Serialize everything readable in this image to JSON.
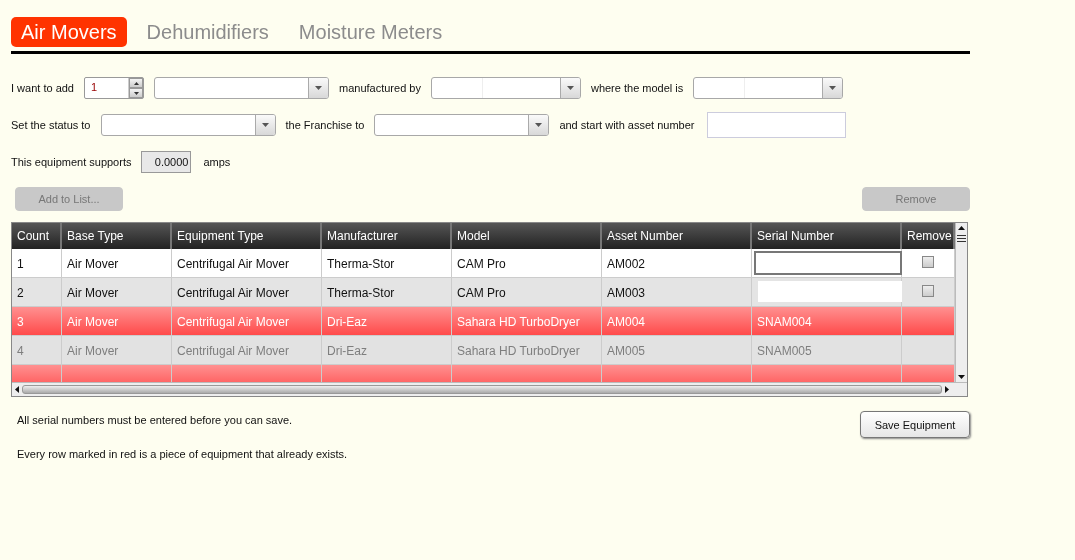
{
  "tabs": [
    {
      "label": "Air Movers",
      "selected": true
    },
    {
      "label": "Dehumidifiers",
      "selected": false
    },
    {
      "label": "Moisture Meters",
      "selected": false
    }
  ],
  "form": {
    "rows": [
      [
        {
          "kind": "label",
          "text": "I want to add"
        },
        {
          "kind": "spinner",
          "value": "1"
        },
        {
          "kind": "dropdown"
        },
        {
          "kind": "label",
          "text": "manufactured by"
        },
        {
          "kind": "split-dropdown"
        },
        {
          "kind": "label",
          "text": "where the model is"
        },
        {
          "kind": "split-dropdown"
        }
      ],
      [
        {
          "kind": "label",
          "text": "Set the status to"
        },
        {
          "kind": "dropdown"
        },
        {
          "kind": "label",
          "text": "the Franchise to"
        },
        {
          "kind": "dropdown"
        },
        {
          "kind": "label",
          "text": "and start with asset number"
        },
        {
          "kind": "textbox"
        }
      ],
      [
        {
          "kind": "label",
          "text": "This equipment supports"
        },
        {
          "kind": "readout",
          "value": "0.0000"
        },
        {
          "kind": "label",
          "text": "amps"
        }
      ]
    ]
  },
  "actions": [
    {
      "label": "Add to List...",
      "disabled": true
    },
    {
      "label": "Remove",
      "disabled": true
    }
  ],
  "grid": {
    "columns": [
      "Count",
      "Base Type",
      "Equipment Type",
      "Manufacturer",
      "Model",
      "Asset Number",
      "Serial Number",
      "Remove"
    ],
    "rows": [
      {
        "kind": "new",
        "cells": [
          "1",
          "Air Mover",
          "Centrifugal Air Mover",
          "Therma-Stor",
          "CAM Pro",
          "AM002"
        ],
        "serial_focused": true,
        "remove_checked": false
      },
      {
        "kind": "new",
        "cells": [
          "2",
          "Air Mover",
          "Centrifugal Air Mover",
          "Therma-Stor",
          "CAM Pro",
          "AM003"
        ],
        "serial_focused": false,
        "remove_checked": false
      },
      {
        "kind": "existing",
        "cells": [
          "3",
          "Air Mover",
          "Centrifugal Air Mover",
          "Dri-Eaz",
          "Sahara HD TurboDryer",
          "AM004",
          "SNAM004"
        ]
      },
      {
        "kind": "faded",
        "cells": [
          "4",
          "Air Mover",
          "Centrifugal Air Mover",
          "Dri-Eaz",
          "Sahara HD TurboDryer",
          "AM005",
          "SNAM005"
        ]
      },
      {
        "kind": "existing"
      }
    ]
  },
  "notes": [
    "All serial numbers must be entered before you can save.",
    "Every row marked in red is a piece of equipment that already exists."
  ],
  "save_button": {
    "label": "Save Equipment",
    "disabled": false
  }
}
